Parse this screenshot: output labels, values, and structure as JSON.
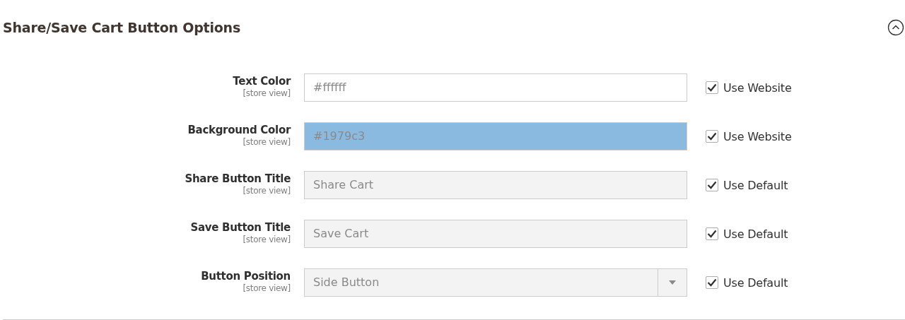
{
  "section": {
    "title": "Share/Save Cart Button Options",
    "expanded": true
  },
  "rows": [
    {
      "label": "Text Color",
      "scope": "[store view]",
      "kind": "text",
      "value": "#ffffff",
      "disabled": true,
      "color": "#ffffff",
      "checkbox": {
        "label": "Use Website",
        "checked": true
      }
    },
    {
      "label": "Background Color",
      "scope": "[store view]",
      "kind": "text",
      "value": "#1979c3",
      "disabled": true,
      "color": "#8bbae1",
      "checkbox": {
        "label": "Use Website",
        "checked": true
      }
    },
    {
      "label": "Share Button Title",
      "scope": "[store view]",
      "kind": "text",
      "value": "Share Cart",
      "disabled": true,
      "checkbox": {
        "label": "Use Default",
        "checked": true
      }
    },
    {
      "label": "Save Button Title",
      "scope": "[store view]",
      "kind": "text",
      "value": "Save Cart",
      "disabled": true,
      "checkbox": {
        "label": "Use Default",
        "checked": true
      }
    },
    {
      "label": "Button Position",
      "scope": "[store view]",
      "kind": "select",
      "value": "Side Button",
      "disabled": true,
      "checkbox": {
        "label": "Use Default",
        "checked": true
      }
    }
  ]
}
